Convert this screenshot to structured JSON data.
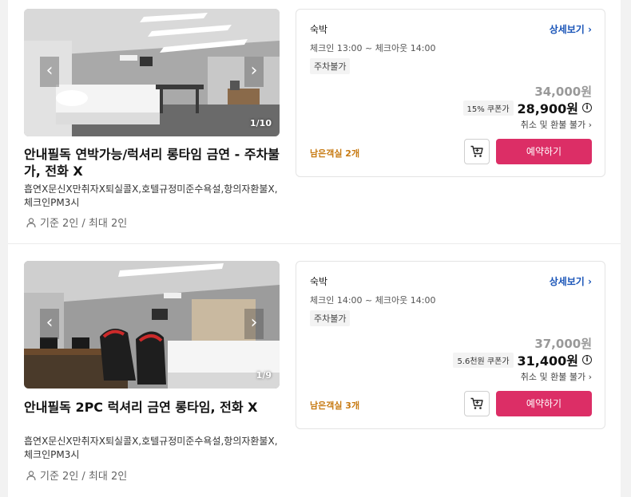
{
  "rooms": [
    {
      "photo_counter": "1/10",
      "name": "안내필독 연박가능/럭셔리 롱타임 금연 - 주차불가, 전화 X",
      "description": "흡연X문신X만취자X퇴실콜X,호텔규정미준수욕설,항의자환불X,체크인PM3시",
      "capacity": "기준 2인 / 최대 2인",
      "card": {
        "type": "숙박",
        "detail_link": "상세보기",
        "checkin": "체크인 13:00 ~ 체크아웃 14:00",
        "parking": "주차불가",
        "original_price": "34,000원",
        "coupon": "15% 쿠폰가",
        "final_price": "28,900원",
        "refund": "취소 및 환불 불가",
        "rooms_left": "남은객실 2개",
        "book_label": "예약하기"
      }
    },
    {
      "photo_counter": "1/9",
      "name": "안내필독 2PC 럭셔리 금연 롱타임, 전화 X",
      "description": "흡연X문신X만취자X퇴실콜X,호텔규정미준수욕설,항의자환불X,체크인PM3시",
      "capacity": "기준 2인 / 최대 2인",
      "card": {
        "type": "숙박",
        "detail_link": "상세보기",
        "checkin": "체크인 14:00 ~ 체크아웃 14:00",
        "parking": "주차불가",
        "original_price": "37,000원",
        "coupon": "5.6천원 쿠폰가",
        "final_price": "31,400원",
        "refund": "취소 및 환불 불가",
        "rooms_left": "남은객실 3개",
        "book_label": "예약하기"
      }
    }
  ],
  "icons": {
    "nav_prev": "chevron-left-icon",
    "nav_next": "chevron-right-icon",
    "capacity": "person-icon",
    "cart": "cart-icon",
    "info": "info-icon",
    "link_chevron": "chevron-right-icon"
  },
  "colors": {
    "accent": "#dc2e66",
    "link": "#1a55b8",
    "rooms_left": "#c77a12"
  }
}
